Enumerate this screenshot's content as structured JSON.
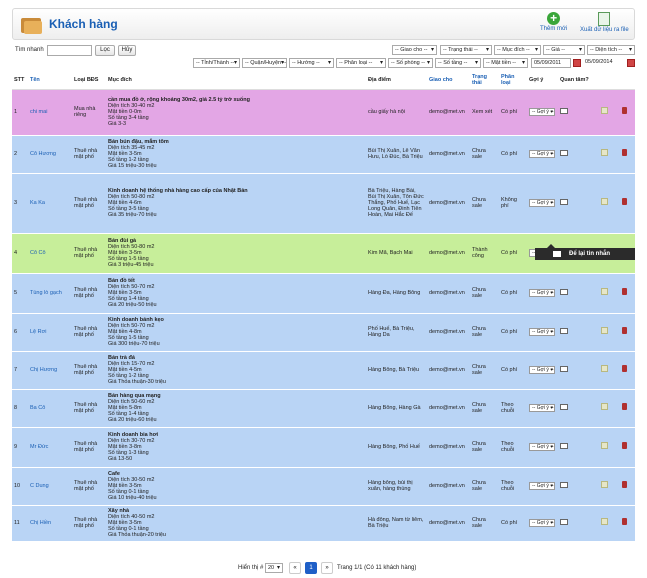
{
  "header": {
    "title": "Khách hàng",
    "add_label": "Thêm mới",
    "export_label": "Xuất dữ liệu ra file"
  },
  "search": {
    "label": "Tìm nhanh",
    "value": "",
    "filter_button": "Lọc",
    "cancel_button": "Hủy"
  },
  "filters_row1": [
    "-- Giao cho --",
    "-- Trạng thái --",
    "-- Mục đích --",
    "-- Giá --",
    "-- Diện tích --"
  ],
  "filters_row2": [
    "-- Tỉnh/Thành --",
    "-- Quận/Huyện --",
    "-- Hướng --",
    "-- Phân loại --",
    "-- Số phòng --",
    "-- Số tầng --",
    "-- Mặt tiền --"
  ],
  "date_from": "05/09/2011",
  "date_to": "05/09/2014",
  "columns": {
    "stt": "STT",
    "name": "Tên",
    "type": "Loại BĐS",
    "purpose": "Mục đích",
    "address": "Địa điểm",
    "assign": "Giao cho",
    "status": "Trạng thái",
    "category": "Phân loại",
    "suggest": "Gợi ý",
    "interest": "Quan tâm?"
  },
  "rows": [
    {
      "stt": "1",
      "name": "chi mai",
      "type": "Mua nhà riêng",
      "purpose_title": "cần mua đồ ở, rộng khoảng 30m2, giá 2.5 tỷ trở xuống",
      "purpose_lines": [
        "Diện tích 30-40 m2",
        "Mặt tiền 0-0m",
        "Số tầng 3-4 tầng",
        "Giá 3-3"
      ],
      "address": "cầu giấy hà nội",
      "assign": "demo@met.vn",
      "status": "Xem xét",
      "category": "Có phí",
      "suggest": "-- Gợi ý --"
    },
    {
      "stt": "2",
      "name": "Cô Hương",
      "type": "Thuê nhà mặt phố",
      "purpose_title": "Bán bún đậu, mắm tôm",
      "purpose_lines": [
        "Diện tích 35-45 m2",
        "Mặt tiền 3-5m",
        "Số tầng 1-2 tầng",
        "Giá 15 triệu-30 triệu"
      ],
      "address": "Bùi Thị Xuân, Lê Văn Hưu, Lò Đúc, Bà Triệu",
      "assign": "demo@met.vn",
      "status": "Chưa sale",
      "category": "Có phí",
      "suggest": "-- Gợi ý --"
    },
    {
      "stt": "3",
      "name": "Ka Ka",
      "type": "Thuê nhà mặt phố",
      "purpose_title": "Kinh doanh hệ thống nhà hàng cao cấp của Nhật Bản",
      "purpose_lines": [
        "Diện tích 50-80 m2",
        "Mặt tiền 4-6m",
        "Số tầng 3-5 tầng",
        "Giá 35 triệu-70 triệu"
      ],
      "address": "Bà Triệu, Hàng Bài, Bùi Thị Xuân, Tôn Đức Thắng, Phố Huế, Lạc Long Quân, Đinh Tiên Hoàn, Mai Hắc Đế",
      "assign": "demo@met.vn",
      "status": "Chưa sale",
      "category": "Không phí",
      "suggest": "-- Gợi ý --"
    },
    {
      "stt": "4",
      "name": "Cô Cô",
      "type": "Thuê nhà mặt phố",
      "purpose_title": "Bán đùi gà",
      "purpose_lines": [
        "Diện tích 50-80 m2",
        "Mặt tiền 3-5m",
        "Số tầng 1-5 tầng",
        "Giá 3 triệu-45 triệu"
      ],
      "address": "Kim Mã, Bạch Mai",
      "assign": "demo@met.vn",
      "status": "Thành công",
      "category": "Có phí",
      "suggest": "-- Gợi ý --"
    },
    {
      "stt": "5",
      "name": "Tùng lò gạch",
      "type": "Thuê nhà mặt phố",
      "purpose_title": "Bán đồ tết",
      "purpose_lines": [
        "Diện tích 50-70 m2",
        "Mặt tiền 3-5m",
        "Số tầng 1-4 tầng",
        "Giá 20 triệu-50 triệu"
      ],
      "address": "Hàng Đa, Hàng Bông",
      "assign": "demo@met.vn",
      "status": "Chưa sale",
      "category": "Có phí",
      "suggest": "-- Gợi ý --"
    },
    {
      "stt": "6",
      "name": "Lệ Rơi",
      "type": "Thuê nhà mặt phố",
      "purpose_title": "Kinh doanh bánh kẹo",
      "purpose_lines": [
        "Diện tích 50-70 m2",
        "Mặt tiền 4-8m",
        "Số tầng 1-5 tầng",
        "Giá 300 triệu-70 triệu"
      ],
      "address": "Phố Huế, Bà Triệu, Hàng Da",
      "assign": "demo@met.vn",
      "status": "Chưa sale",
      "category": "Có phí",
      "suggest": "-- Gợi ý --"
    },
    {
      "stt": "7",
      "name": "Chị Hương",
      "type": "Thuê nhà mặt phố",
      "purpose_title": "Bán trà đá",
      "purpose_lines": [
        "Diện tích 15-70 m2",
        "Mặt tiền 4-5m",
        "Số tầng 1-2 tầng",
        "Giá Thỏa thuận-30 triệu"
      ],
      "address": "Hàng Bông, Bà Triệu",
      "assign": "demo@met.vn",
      "status": "Chưa sale",
      "category": "Có phí",
      "suggest": "-- Gợi ý --"
    },
    {
      "stt": "8",
      "name": "Ba Cô",
      "type": "Thuê nhà mặt phố",
      "purpose_title": "Bán hàng qua mạng",
      "purpose_lines": [
        "Diện tích 50-60 m2",
        "Mặt tiền 5-8m",
        "Số tầng 1-4 tầng",
        "Giá 20 triệu-60 triệu"
      ],
      "address": "Hàng Bông, Hàng Gà",
      "assign": "demo@met.vn",
      "status": "Chưa sale",
      "category": "Theo chuỗi",
      "suggest": "-- Gợi ý --"
    },
    {
      "stt": "9",
      "name": "Mr Đức",
      "type": "Thuê nhà mặt phố",
      "purpose_title": "Kinh doanh bia hơi",
      "purpose_lines": [
        "Diện tích 30-70 m2",
        "Mặt tiền 3-8m",
        "Số tầng 1-3 tầng",
        "Giá 13-50"
      ],
      "address": "Hàng Bông, Phố Huế",
      "assign": "demo@met.vn",
      "status": "Chưa sale",
      "category": "Theo chuỗi",
      "suggest": "-- Gợi ý --"
    },
    {
      "stt": "10",
      "name": "C Dung",
      "type": "Thuê nhà mặt phố",
      "purpose_title": "Cafe",
      "purpose_lines": [
        "Diện tích 30-50 m2",
        "Mặt tiền 3-5m",
        "Số tầng 0-1 tầng",
        "Giá 10 triệu-40 triệu"
      ],
      "address": "Hàng bông, bùi thị xuân, hàng thùng",
      "assign": "demo@met.vn",
      "status": "Chưa sale",
      "category": "Theo chuỗi",
      "suggest": "-- Gợi ý --"
    },
    {
      "stt": "11",
      "name": "Chị Hiền",
      "type": "Thuê nhà mặt phố",
      "purpose_title": "Xây nhà",
      "purpose_lines": [
        "Diện tích 40-50 m2",
        "Mặt tiền 3-5m",
        "Số tầng 0-1 tầng",
        "Giá Thỏa thuận-20 triệu"
      ],
      "address": "Hà đông, Nam từ liêm, Bà Triệu",
      "assign": "demo@met.vn",
      "status": "Chưa sale",
      "category": "Có phí",
      "suggest": "-- Gợi ý --"
    }
  ],
  "row_colors": [
    "pink",
    "blue",
    "blue",
    "green",
    "blue",
    "blue",
    "blue",
    "blue",
    "blue",
    "blue",
    "blue"
  ],
  "tooltip": "Để lại tin nhắn",
  "pager": {
    "show_label": "Hiển thị #",
    "per_page": "20",
    "prev": "«",
    "current": "1",
    "next": "»",
    "summary": "Trang 1/1 (Có 11 khách hàng)"
  }
}
